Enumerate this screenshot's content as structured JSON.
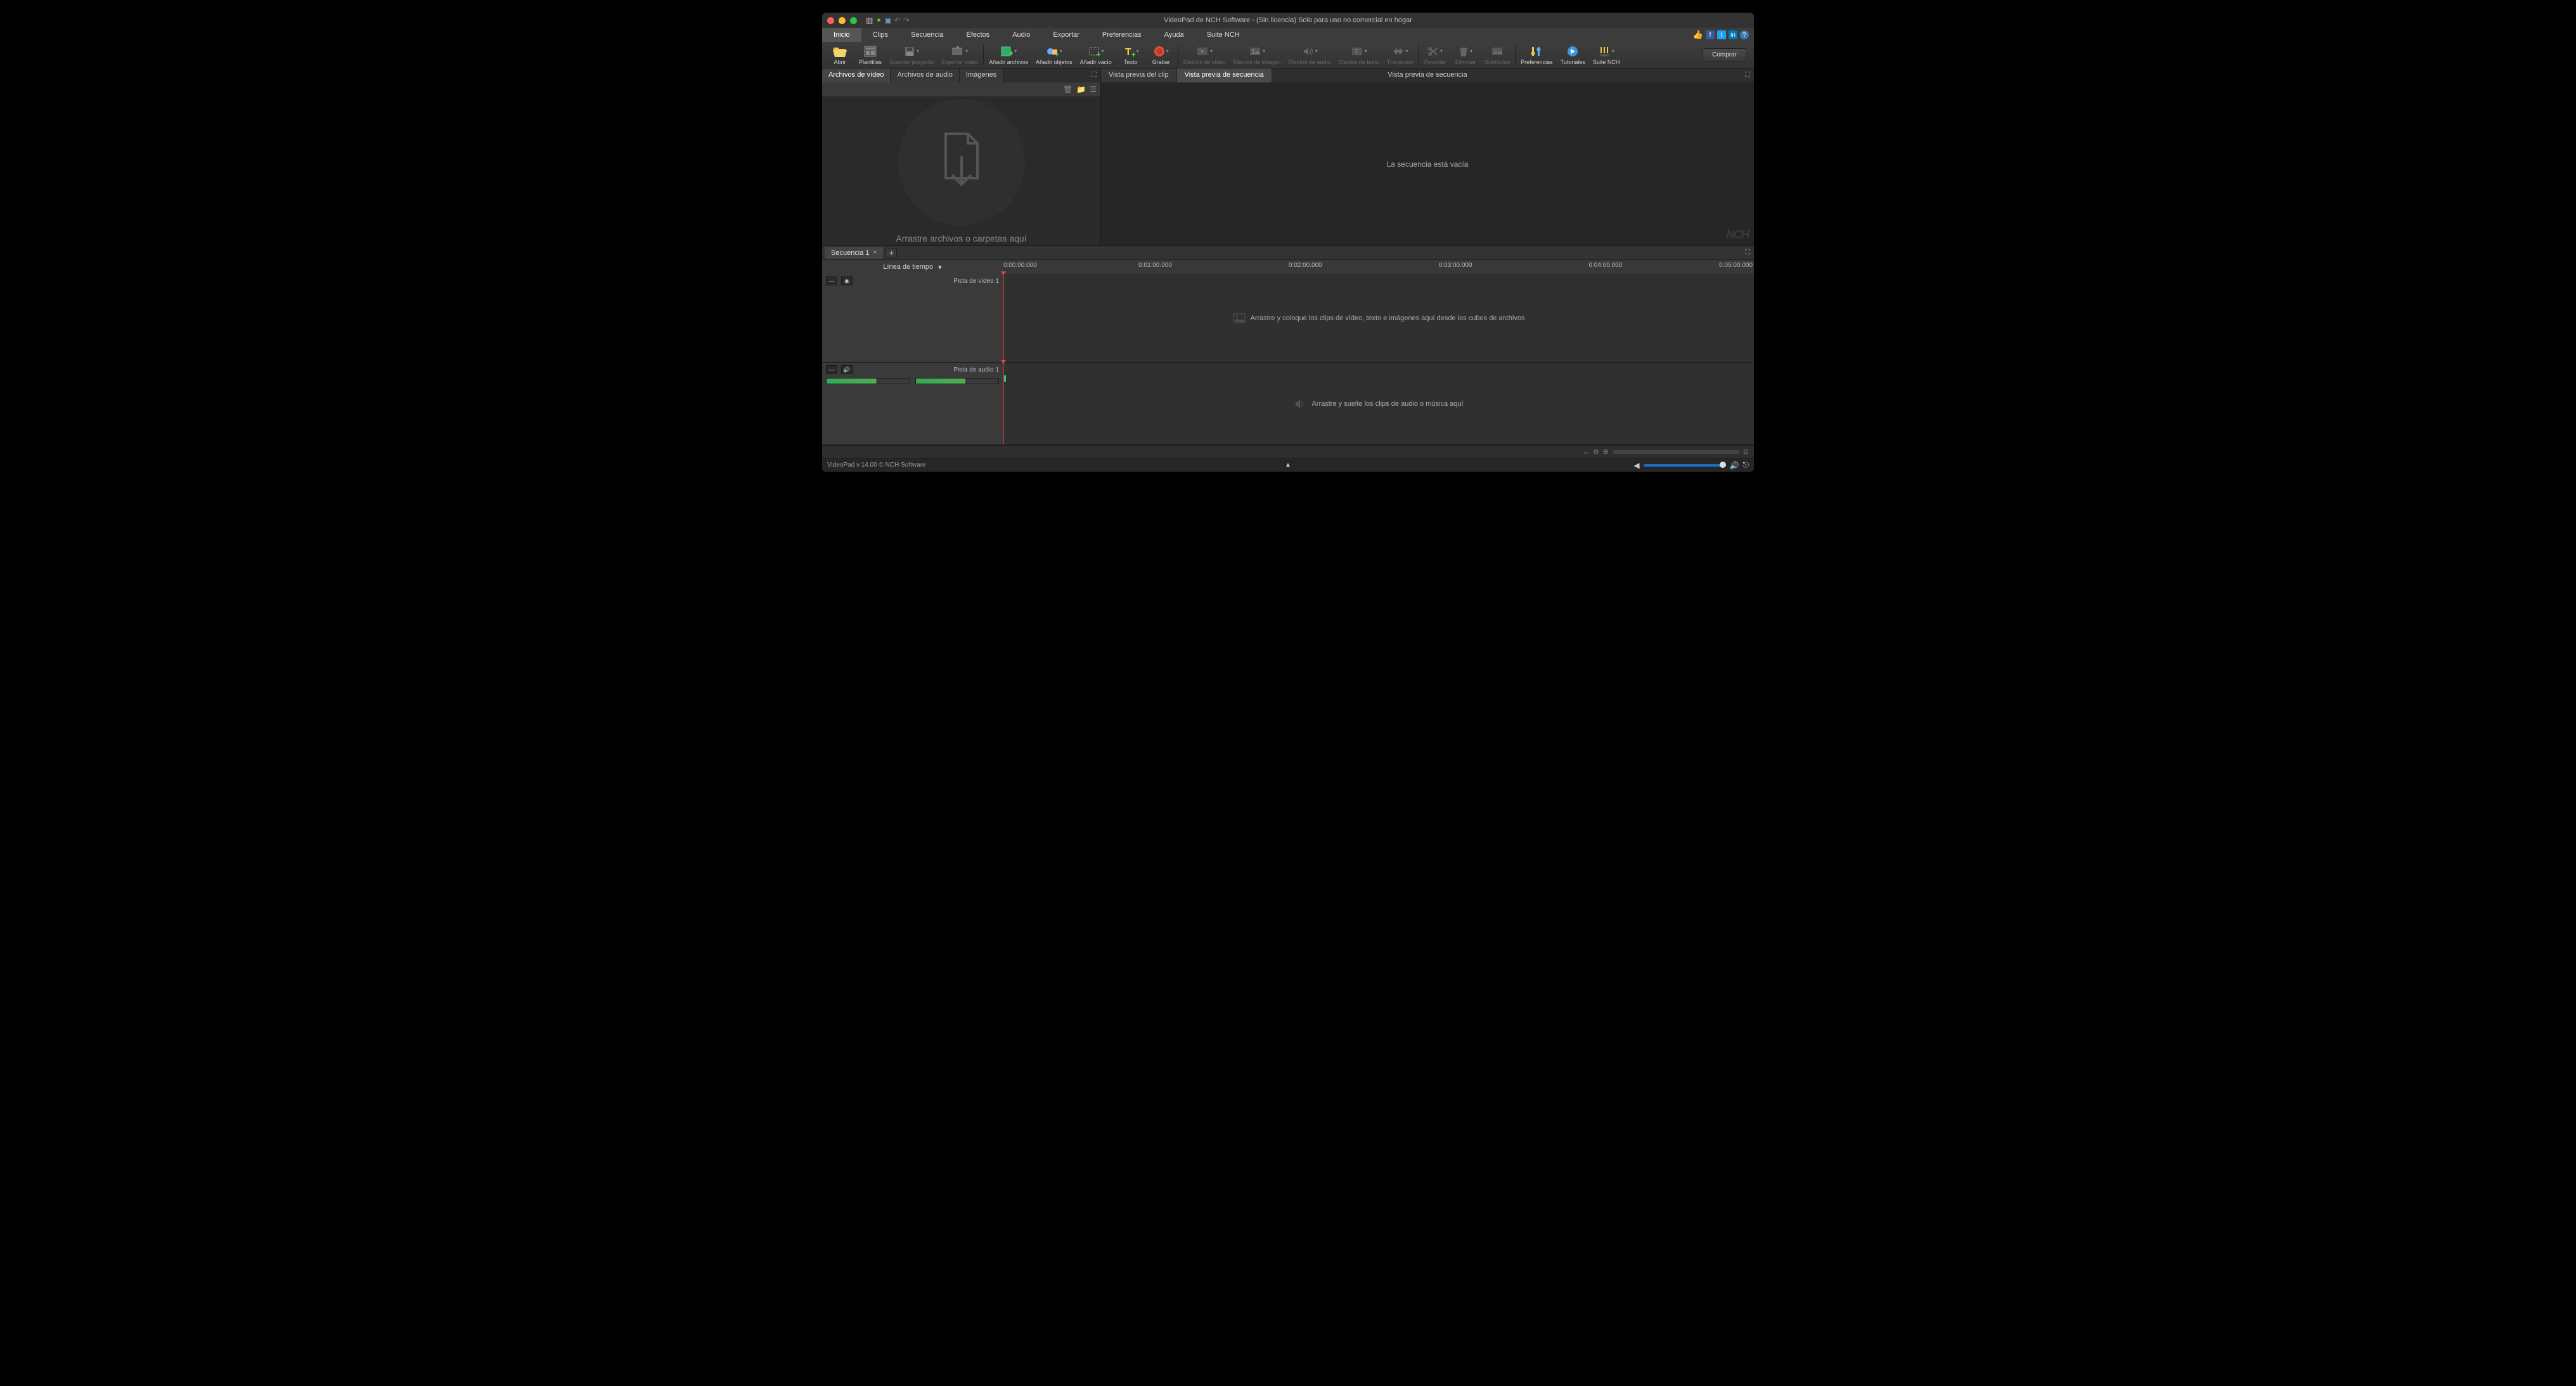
{
  "titlebar": {
    "title": "VideoPad de NCH Software - (Sin licencia) Solo para uso no comercial en hogar"
  },
  "menubar": {
    "items": [
      "Inicio",
      "Clips",
      "Secuencia",
      "Efectos",
      "Audio",
      "Exportar",
      "Preferencias",
      "Ayuda",
      "Suite NCH"
    ],
    "active_index": 0
  },
  "toolbar": {
    "open": "Abrir",
    "templates": "Plantillas",
    "save_project": "Guardar proyecto",
    "export_video": "Exportar video",
    "add_files": "Añadir archivos",
    "add_objects": "Añadir objetos",
    "add_blank": "Añadir vacío",
    "text": "Texto",
    "record": "Grabar",
    "video_effects": "Efectos de vídeo",
    "image_effects": "Efectos de imagen",
    "audio_effects": "Efectos de audio",
    "text_effects": "Efectos de texto",
    "transition": "Transición",
    "trim": "Recortar",
    "delete": "Eliminar",
    "subtitles": "Subtítulos",
    "preferences": "Preferencias",
    "tutorials": "Tutoriales",
    "suite_nch": "Suite NCH",
    "buy": "Comprar"
  },
  "bins": {
    "tabs": [
      "Archivos de vídeo",
      "Archivos de audio",
      "Imágenes"
    ],
    "active_index": 0,
    "drop_text": "Arrastre archivos o carpetas aquí"
  },
  "preview": {
    "tabs": [
      "Vista previa del clip",
      "Vista previa de secuencia"
    ],
    "active_index": 1,
    "title": "Vista previa de secuencia",
    "empty_text": "La secuencia está vacía",
    "watermark": "NCH"
  },
  "sequence": {
    "tab_name": "Secuencia 1"
  },
  "timeline": {
    "mode_label": "Línea de tiempo",
    "stamps": [
      "0:00:00.000",
      "0:01:00.000",
      "0:02:00.000",
      "0:03:00.000",
      "0:04:00.000",
      "0:05:00.000"
    ],
    "video_track": {
      "name": "Pista de vídeo 1",
      "hint": "Arrastre y coloque los clips de vídeo, texto e imágenes aquí desde los cubos de archivos"
    },
    "audio_track": {
      "name": "Pista de audio 1",
      "hint": "Arrastre y suelte los clips de audio o música aquí"
    }
  },
  "statusbar": {
    "version": "VideoPad v 14.00 © NCH Software"
  }
}
